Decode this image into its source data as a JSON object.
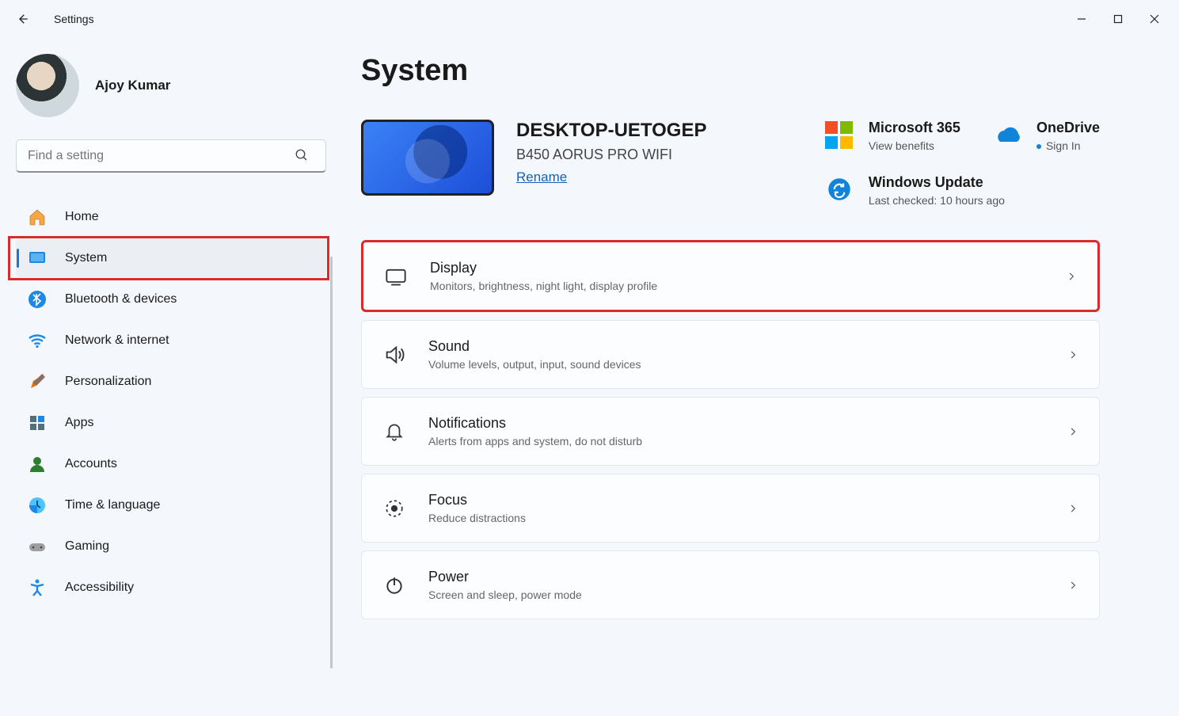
{
  "titlebar": {
    "title": "Settings"
  },
  "user": {
    "name": "Ajoy Kumar"
  },
  "search": {
    "placeholder": "Find a setting"
  },
  "nav": [
    {
      "label": "Home"
    },
    {
      "label": "System"
    },
    {
      "label": "Bluetooth & devices"
    },
    {
      "label": "Network & internet"
    },
    {
      "label": "Personalization"
    },
    {
      "label": "Apps"
    },
    {
      "label": "Accounts"
    },
    {
      "label": "Time & language"
    },
    {
      "label": "Gaming"
    },
    {
      "label": "Accessibility"
    }
  ],
  "page": {
    "title": "System"
  },
  "device": {
    "name": "DESKTOP-UETOGEP",
    "model": "B450 AORUS PRO WIFI",
    "rename": "Rename"
  },
  "promo": {
    "ms365": {
      "title": "Microsoft 365",
      "sub": "View benefits"
    },
    "onedrive": {
      "title": "OneDrive",
      "sub": "Sign In"
    },
    "update": {
      "title": "Windows Update",
      "sub": "Last checked: 10 hours ago"
    }
  },
  "settings": [
    {
      "title": "Display",
      "sub": "Monitors, brightness, night light, display profile"
    },
    {
      "title": "Sound",
      "sub": "Volume levels, output, input, sound devices"
    },
    {
      "title": "Notifications",
      "sub": "Alerts from apps and system, do not disturb"
    },
    {
      "title": "Focus",
      "sub": "Reduce distractions"
    },
    {
      "title": "Power",
      "sub": "Screen and sleep, power mode"
    }
  ]
}
